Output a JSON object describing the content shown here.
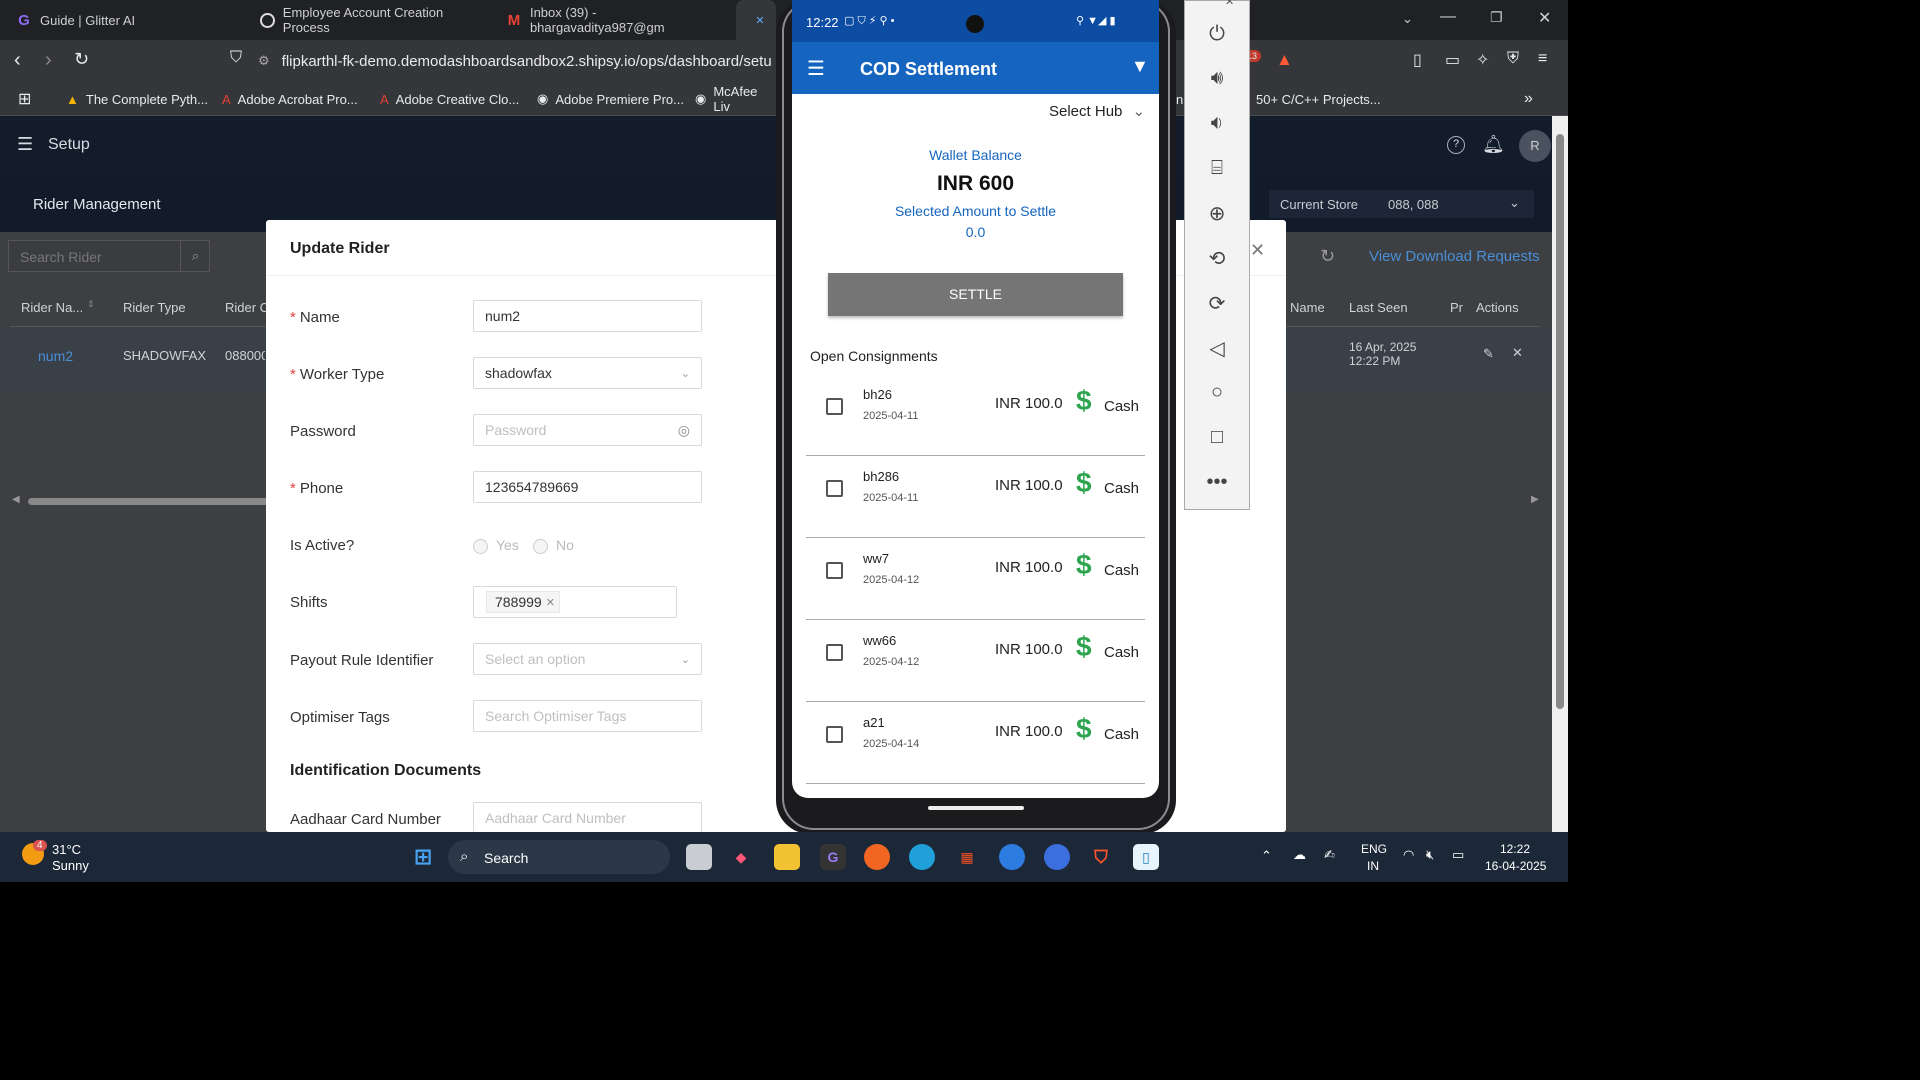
{
  "browser": {
    "tabs": [
      {
        "label": "Guide | Glitter AI",
        "icon": "glitter-icon"
      },
      {
        "label": "Employee Account Creation Process",
        "icon": "chatgpt-icon"
      },
      {
        "label": "Inbox (39) - bhargavaditya987@gm",
        "icon": "gmail-icon"
      },
      {
        "label": "",
        "icon": "shipsy-icon"
      }
    ],
    "url": "flipkarthl-fk-demo.demodashboardsandbox2.shipsy.io/ops/dashboard/setu",
    "extension_badge": "13",
    "bookmarks": [
      {
        "label": "The Complete Pyth...",
        "icon": "google-drive-icon"
      },
      {
        "label": "Adobe Acrobat Pro...",
        "icon": "adobe-icon"
      },
      {
        "label": "Adobe Creative Clo...",
        "icon": "adobe-icon"
      },
      {
        "label": "Adobe Premiere Pro...",
        "icon": "globe-icon"
      },
      {
        "label": "McAfee Liv",
        "icon": "globe-icon"
      },
      {
        "label": "n",
        "icon": ""
      },
      {
        "label": "50+ C/C++ Projects...",
        "icon": ""
      }
    ]
  },
  "dashboard": {
    "topbar_title": "Setup",
    "avatar_initial": "R",
    "section_title": "Rider Management",
    "current_store_label": "Current Store",
    "current_store_value": "088, 088",
    "search_placeholder": "Search Rider",
    "view_download_requests": "View Download Requests",
    "columns": [
      "Rider Na...",
      "Rider Type",
      "Rider C",
      "Name",
      "Last Seen",
      "Pr",
      "Actions"
    ],
    "row": {
      "name": "num2",
      "type": "SHADOWFAX",
      "code": "088000",
      "last_seen": "16 Apr, 2025\n12:22 PM"
    }
  },
  "modal": {
    "title": "Update Rider",
    "fields": {
      "name_label": "Name",
      "name_value": "num2",
      "worker_type_label": "Worker Type",
      "worker_type_value": "shadowfax",
      "password_label": "Password",
      "password_placeholder": "Password",
      "phone_label": "Phone",
      "phone_value": "123654789669",
      "is_active_label": "Is Active?",
      "yes": "Yes",
      "no": "No",
      "shifts_label": "Shifts",
      "shift_tag": "788999",
      "payout_label": "Payout Rule Identifier",
      "payout_placeholder": "Select an option",
      "optimiser_label": "Optimiser Tags",
      "optimiser_placeholder": "Search Optimiser Tags",
      "id_docs_heading": "Identification Documents",
      "aadhaar_label": "Aadhaar Card Number",
      "aadhaar_placeholder": "Aadhaar Card Number"
    }
  },
  "phone": {
    "time": "12:22",
    "title": "COD Settlement",
    "select_hub": "Select Hub",
    "wallet_label": "Wallet Balance",
    "wallet_value": "INR 600",
    "selected_label": "Selected Amount to Settle",
    "selected_value": "0.0",
    "settle_button": "SETTLE",
    "open_heading": "Open Consignments",
    "consignments": [
      {
        "id": "bh26",
        "date": "2025-04-11",
        "amount": "INR 100.0",
        "mode": "Cash"
      },
      {
        "id": "bh286",
        "date": "2025-04-11",
        "amount": "INR 100.0",
        "mode": "Cash"
      },
      {
        "id": "ww7",
        "date": "2025-04-12",
        "amount": "INR 100.0",
        "mode": "Cash"
      },
      {
        "id": "ww66",
        "date": "2025-04-12",
        "amount": "INR 100.0",
        "mode": "Cash"
      },
      {
        "id": "a21",
        "date": "2025-04-14",
        "amount": "INR 100.0",
        "mode": "Cash"
      }
    ]
  },
  "taskbar": {
    "weather_badge": "4",
    "temperature": "31°C",
    "condition": "Sunny",
    "search_label": "Search",
    "language": "ENG",
    "region": "IN",
    "clock_time": "12:22",
    "clock_date": "16-04-2025"
  },
  "colors": {
    "accent_blue": "#1565c0",
    "cash_green": "#2ea44f",
    "required_red": "#e2443c",
    "settle_gray": "#757575"
  }
}
